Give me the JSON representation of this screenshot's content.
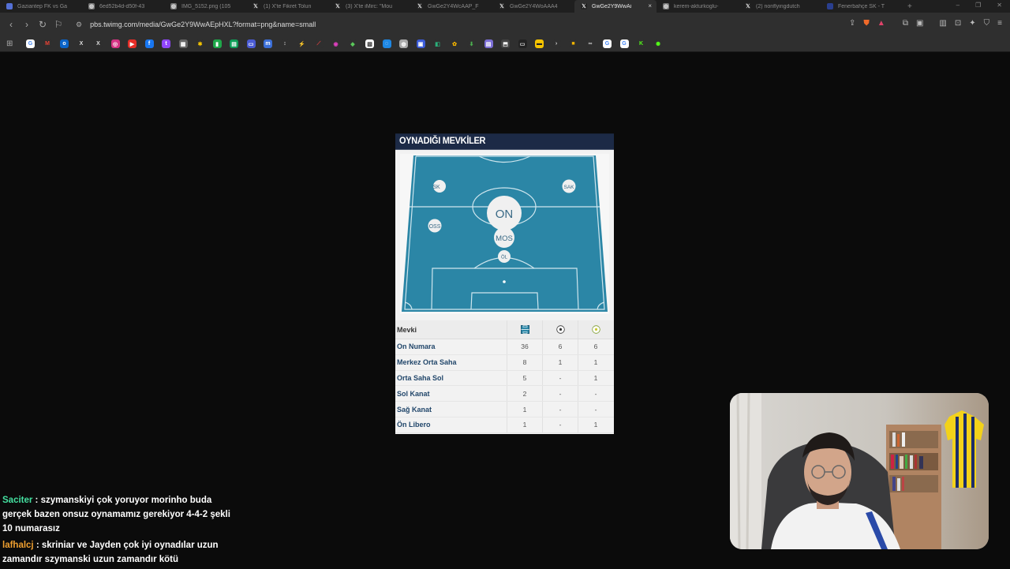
{
  "browser": {
    "tabs": [
      {
        "title": "Gaziantep FK vs Ga",
        "fav": "doc-icon",
        "color": "#5470d6"
      },
      {
        "title": "6ed52b4d-d50f-43",
        "fav": "globe-icon",
        "color": "#777777"
      },
      {
        "title": "IMG_5152.png (105",
        "fav": "globe-icon",
        "color": "#777777"
      },
      {
        "title": "(1) X'te Fikret Tolun",
        "fav": "x-icon",
        "color": "#222222"
      },
      {
        "title": "(3) X'te iMirc: \"Mou",
        "fav": "x-icon",
        "color": "#222222"
      },
      {
        "title": "GwGe2Y4WcAAP_F",
        "fav": "x-icon",
        "color": "#222222"
      },
      {
        "title": "GwGe2Y4WoAAA4",
        "fav": "x-icon",
        "color": "#222222"
      },
      {
        "title": "GwGe2Y9WwAi",
        "fav": "x-icon",
        "color": "#222222",
        "active": true
      },
      {
        "title": "kerem-akturkoglu-",
        "fav": "globe-icon",
        "color": "#777777"
      },
      {
        "title": "(2) nonflyingdutch",
        "fav": "x-icon",
        "color": "#222222"
      },
      {
        "title": "Fenerbahçe SK - T",
        "fav": "flag-icon",
        "color": "#2a3f8f"
      }
    ],
    "tab_close": "×",
    "new_tab": "+",
    "url": "pbs.twimg.com/media/GwGe2Y9WwAEpHXL?format=png&name=small",
    "window_controls": [
      "–",
      "❐",
      "✕"
    ]
  },
  "card": {
    "title": "OYNADIĞI MEVKİLER",
    "positions": [
      {
        "label": "ON",
        "kind": "big"
      },
      {
        "label": "MOS",
        "kind": "mid"
      },
      {
        "label": "ÖL",
        "kind": "small"
      },
      {
        "label": "OSS",
        "kind": "small"
      },
      {
        "label": "SK",
        "kind": "small"
      },
      {
        "label": "SAK",
        "kind": "small"
      }
    ],
    "table": {
      "header": "Mevki",
      "rows": [
        {
          "name": "On Numara",
          "v1": "36",
          "v2": "6",
          "v3": "6"
        },
        {
          "name": "Merkez Orta Saha",
          "v1": "8",
          "v2": "1",
          "v3": "1"
        },
        {
          "name": "Orta Saha Sol",
          "v1": "5",
          "v2": "-",
          "v3": "1"
        },
        {
          "name": "Sol Kanat",
          "v1": "2",
          "v2": "-",
          "v3": "-"
        },
        {
          "name": "Sağ Kanat",
          "v1": "1",
          "v2": "-",
          "v3": "-"
        },
        {
          "name": "Ön Libero",
          "v1": "1",
          "v2": "-",
          "v3": "1"
        }
      ]
    }
  },
  "chat": [
    {
      "user": "Saciter",
      "sep": " : ",
      "text": "szymanskiyi çok yoruyor morinho buda gerçek bazen onsuz oynamamız gerekiyor 4-4-2 şekli 10 numarasız"
    },
    {
      "user": "lafhalcj",
      "sep": " : ",
      "text": "skriniar ve Jayden çok iyi oynadılar uzun zamandır szymanski uzun zamandır kötü"
    }
  ],
  "colors": {
    "pitch": "#2b86a6",
    "pitch_line": "#cfe6ee",
    "header_bg": "#1c2a46",
    "row_text": "#22476b"
  }
}
